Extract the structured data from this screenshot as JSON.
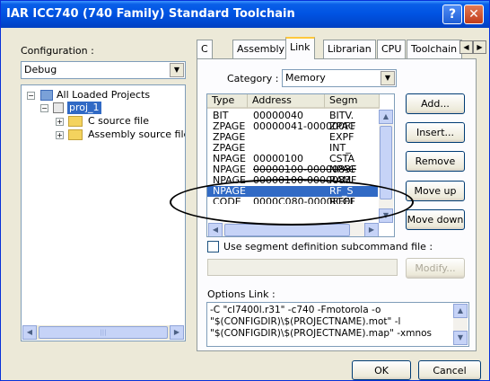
{
  "window": {
    "title": "IAR ICC740 (740 Family) Standard Toolchain",
    "help_glyph": "?",
    "close_glyph": "✕"
  },
  "left": {
    "config_label": "Configuration :",
    "config_value": "Debug",
    "tree": [
      {
        "label": "All Loaded Projects",
        "expander": "−"
      },
      {
        "label": "proj_1",
        "expander": "−"
      },
      {
        "label": "C source file",
        "expander": "+"
      },
      {
        "label": "Assembly source file",
        "expander": "+"
      }
    ]
  },
  "tabs": [
    "C",
    "Assembly",
    "Link",
    "Librarian",
    "CPU",
    "Toolchain"
  ],
  "category": {
    "label": "Category :",
    "value": "Memory"
  },
  "table": {
    "headers": [
      "Type",
      "Address",
      "Segm"
    ],
    "rows": [
      [
        "BIT",
        "00000040",
        "BITV."
      ],
      [
        "ZPAGE",
        "00000041-000000FF",
        "ZPAC"
      ],
      [
        "ZPAGE",
        "",
        "EXPF"
      ],
      [
        "ZPAGE",
        "",
        "INT_"
      ],
      [
        "NPAGE",
        "00000100",
        "CSTA"
      ],
      [
        "NPAGE",
        "00000100-0000083F",
        "NPAC"
      ],
      [
        "NPAGE",
        "00000100-0000083F",
        "RAM"
      ],
      [
        "NPAGE",
        "",
        "RF_S"
      ],
      [
        "CODE",
        "0000C080-0000FFFF",
        "RCOI"
      ]
    ]
  },
  "buttons": {
    "add": "Add...",
    "insert": "Insert...",
    "remove": "Remove",
    "move_up": "Move up",
    "move_down": "Move down",
    "modify": "Modify...",
    "ok": "OK",
    "cancel": "Cancel"
  },
  "use_segment_label": "Use segment definition subcommand file :",
  "options": {
    "label": "Options Link :",
    "lines": [
      "-C \"cl7400l.r31\" -c740 -Fmotorola -o",
      "\"$(CONFIGDIR)\\$(PROJECTNAME).mot\" -l",
      "\"$(CONFIGDIR)\\$(PROJECTNAME).map\" -xmnos"
    ]
  }
}
